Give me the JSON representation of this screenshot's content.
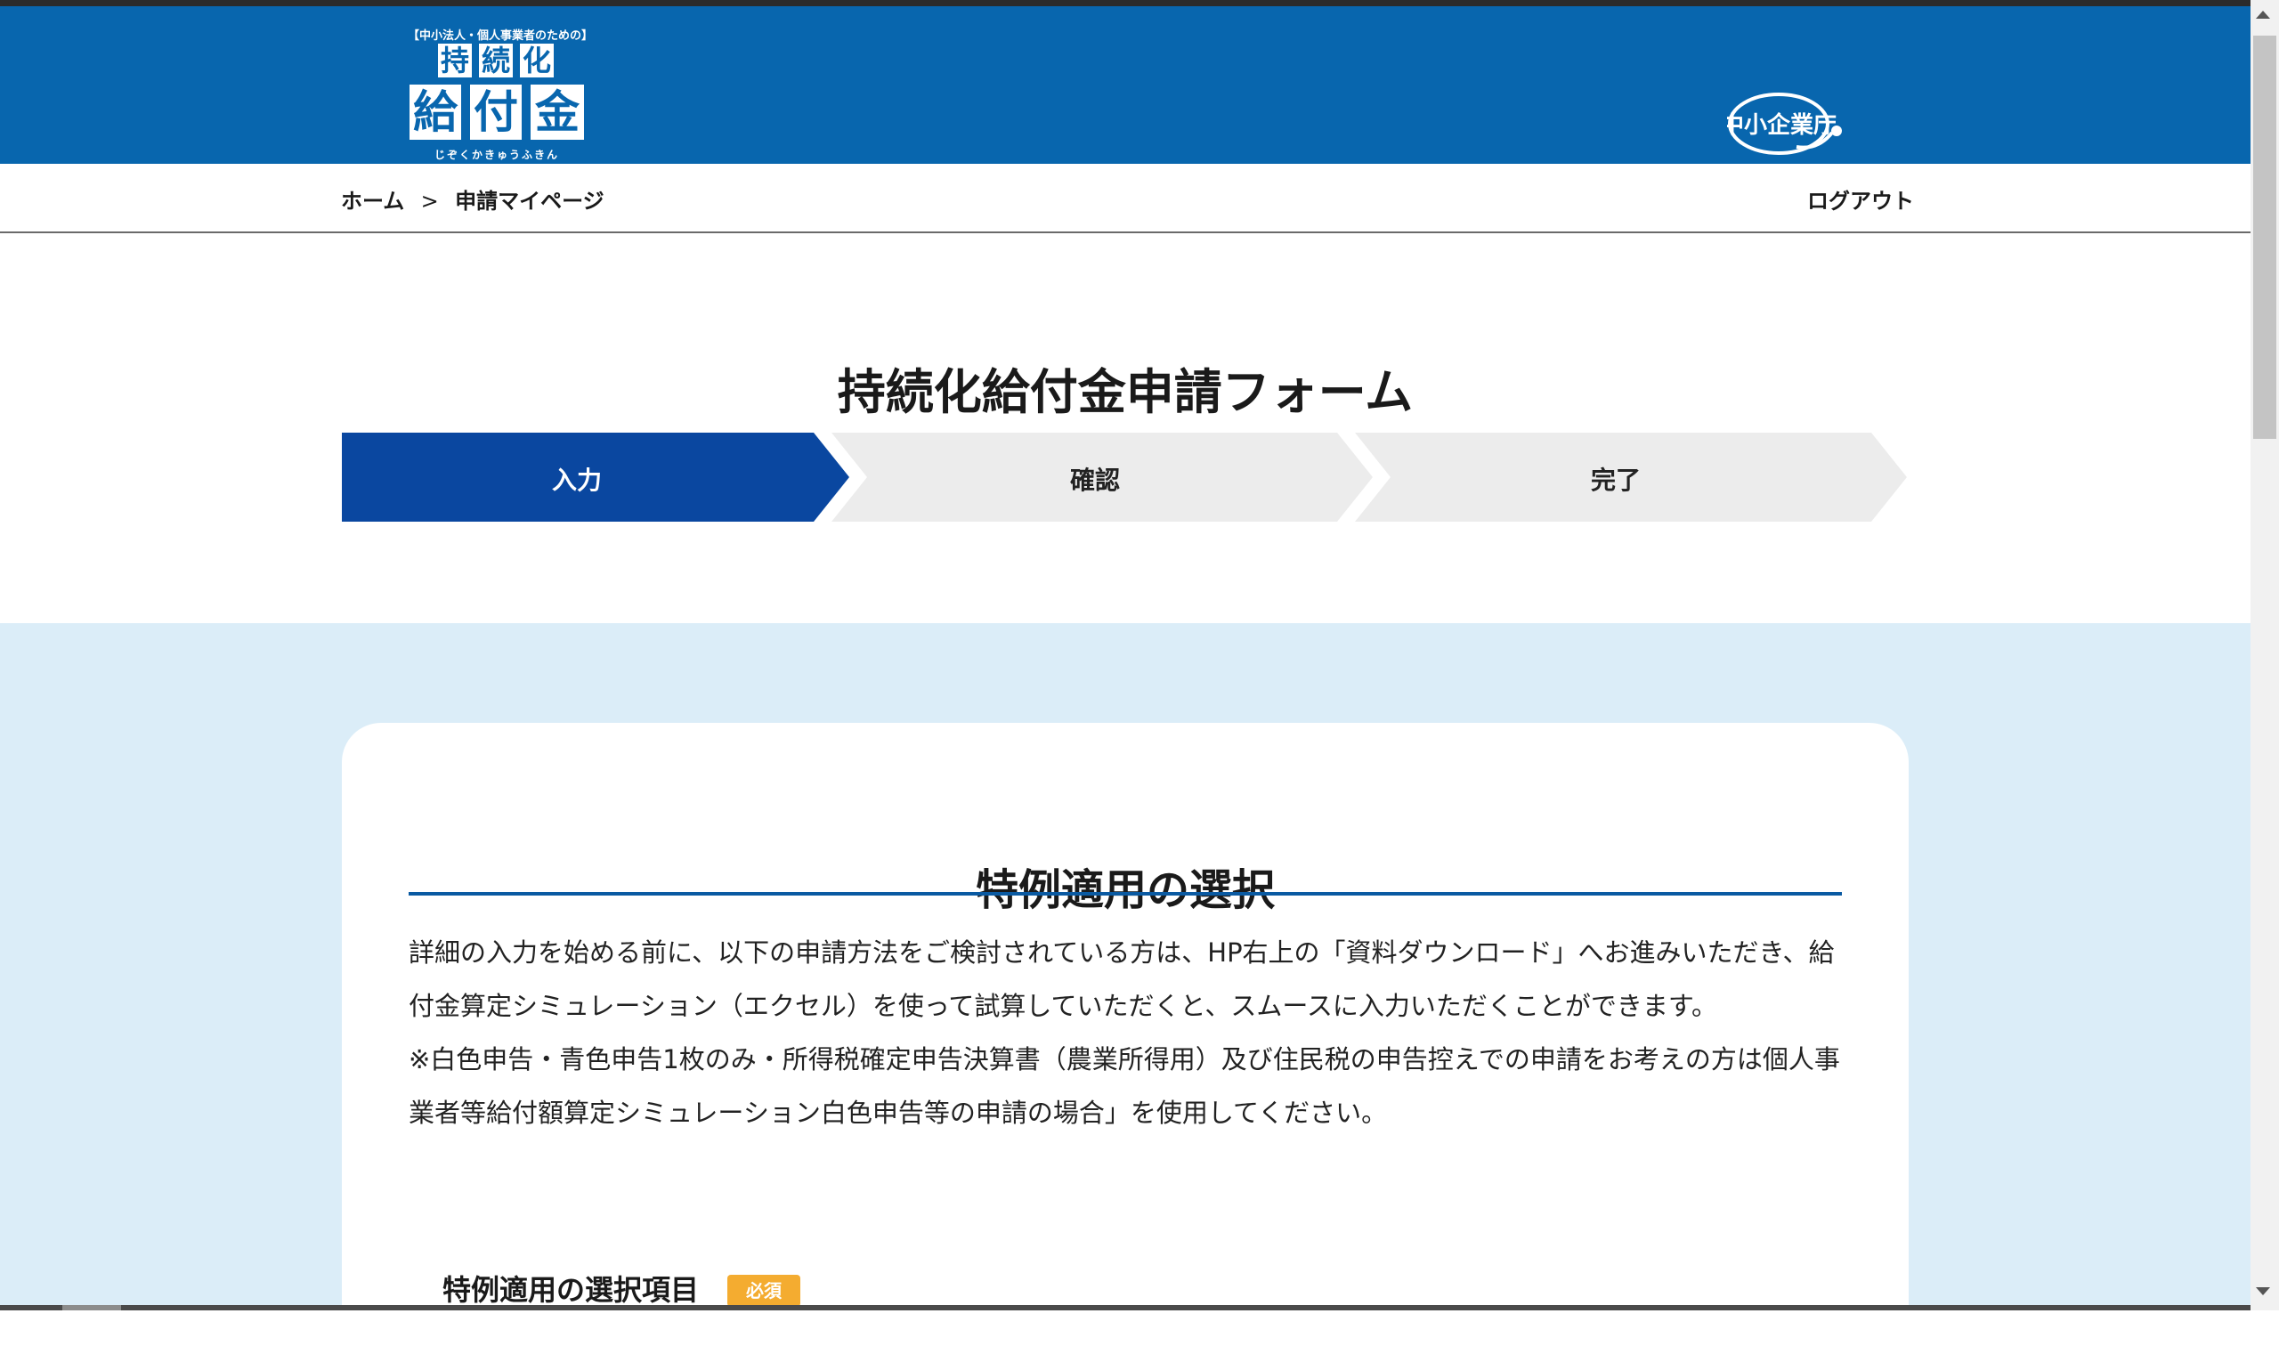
{
  "logo": {
    "subtitle": "【中小法人・個人事業者のための】",
    "row1": [
      "持",
      "続",
      "化"
    ],
    "row2": [
      "給",
      "付",
      "金"
    ],
    "kana": "じぞくかきゅうふきん"
  },
  "agency_logo": {
    "text": "中小企業庁"
  },
  "breadcrumb": {
    "home": "ホーム",
    "separator": ">",
    "current": "申請マイページ"
  },
  "header": {
    "logout_label": "ログアウト"
  },
  "page": {
    "title": "持続化給付金申請フォーム"
  },
  "steps": [
    {
      "label": "入力",
      "active": true
    },
    {
      "label": "確認",
      "active": false
    },
    {
      "label": "完了",
      "active": false
    }
  ],
  "section": {
    "title": "特例適用の選択",
    "intro_paragraph_1": "詳細の入力を始める前に、以下の申請方法をご検討されている方は、HP右上の「資料ダウンロード」へお進みいただき、給付金算定シミュレーション（エクセル）を使って試算していただくと、スムースに入力いただくことができます。",
    "intro_paragraph_2": "※白色申告・青色申告1枚のみ・所得税確定申告決算書（農業所得用）及び住民税の申告控えでの申請をお考えの方は個人事業者等給付額算定シミュレーション白色申告等の申請の場合」を使用してください。",
    "select_label": "特例適用の選択項目",
    "required_badge": "必須"
  },
  "colors": {
    "header_bg": "#0866ae",
    "step_active": "#0a47a0",
    "step_inactive": "#ececec",
    "band_bg": "#dbedf8",
    "required_badge": "#f4ac30"
  }
}
